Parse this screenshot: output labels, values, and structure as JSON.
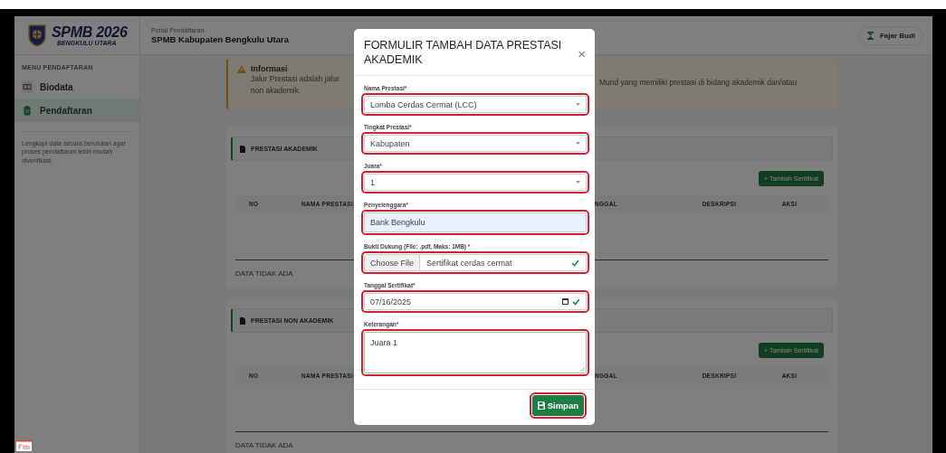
{
  "header": {
    "logo_title": "SPMB 2026",
    "logo_subtitle": "BENGKULU UTARA",
    "portal_label": "Portal Pendaftaran",
    "portal_title": "SPMB Kabupaten Bengkulu Utara",
    "user_name": "Fajar Budi"
  },
  "sidebar": {
    "heading": "MENU PENDAFTARAN",
    "items": [
      {
        "label": "Biodata",
        "selected": false
      },
      {
        "label": "Pendaftaran",
        "selected": true
      }
    ],
    "note": "Lengkapi data secara berurutan agar proses pendaftaran lebih mudah diverifikasi."
  },
  "info": {
    "title": "Informasi",
    "text_left": [
      "Jalur Prestasi adalah jalur",
      "non akademik."
    ],
    "text_right": "Murid yang memiliki prestasi di bidang akademik dan/atau"
  },
  "sections": [
    {
      "title": "PRESTASI AKADEMIK",
      "add_button": "+ Tambah Sertifikat",
      "columns_left": [
        "NO",
        "NAMA PRESTASI"
      ],
      "columns_right": [
        "NGGAL",
        "DESKRIPSI",
        "AKSI"
      ],
      "empty_text": "DATA TIDAK ADA"
    },
    {
      "title": "PRESTASI NON AKADEMIK",
      "add_button": "+ Tambah Sertifikat",
      "columns_left": [
        "NO",
        "NAMA PRESTASI"
      ],
      "columns_right": [
        "NGGAL",
        "DESKRIPSI",
        "AKSI"
      ],
      "empty_text": "DATA TIDAK ADA"
    }
  ],
  "modal": {
    "title": "FORMULIR TAMBAH DATA PRESTASI AKADEMIK",
    "close": "×",
    "fields": [
      {
        "kind": "select",
        "label": "Nama Prestasi",
        "required_mark": "*",
        "value": "Lomba Cerdas Cermat (LCC)",
        "highlighted": true
      },
      {
        "kind": "select",
        "label": "Tingkat Prestasi",
        "required_mark": "*",
        "value": "Kabupaten",
        "highlighted": true
      },
      {
        "kind": "select",
        "label": "Juara",
        "required_mark": "*",
        "value": "1",
        "highlighted": true
      },
      {
        "kind": "text",
        "label": "Penyelenggara",
        "required_mark": "*",
        "value": "Bank Bengkulu",
        "highlighted": true
      },
      {
        "kind": "file",
        "label": "Bukti Dukung (File: .pdf, Maks: 1MB) ",
        "required_mark": "*",
        "button": "Choose File",
        "value": "Sertifikat cerdas cermat",
        "valid": true,
        "highlighted": true
      },
      {
        "kind": "date",
        "label": "Tanggal Sertifikat",
        "required_mark": "*",
        "value": "07/16/2025",
        "valid": true,
        "highlighted": true
      },
      {
        "kind": "textarea",
        "label": "Keterangan",
        "required_mark": "*",
        "value": "Juara 1",
        "highlighted": true
      }
    ],
    "submit": {
      "label": "Simpan",
      "highlighted": true
    }
  }
}
